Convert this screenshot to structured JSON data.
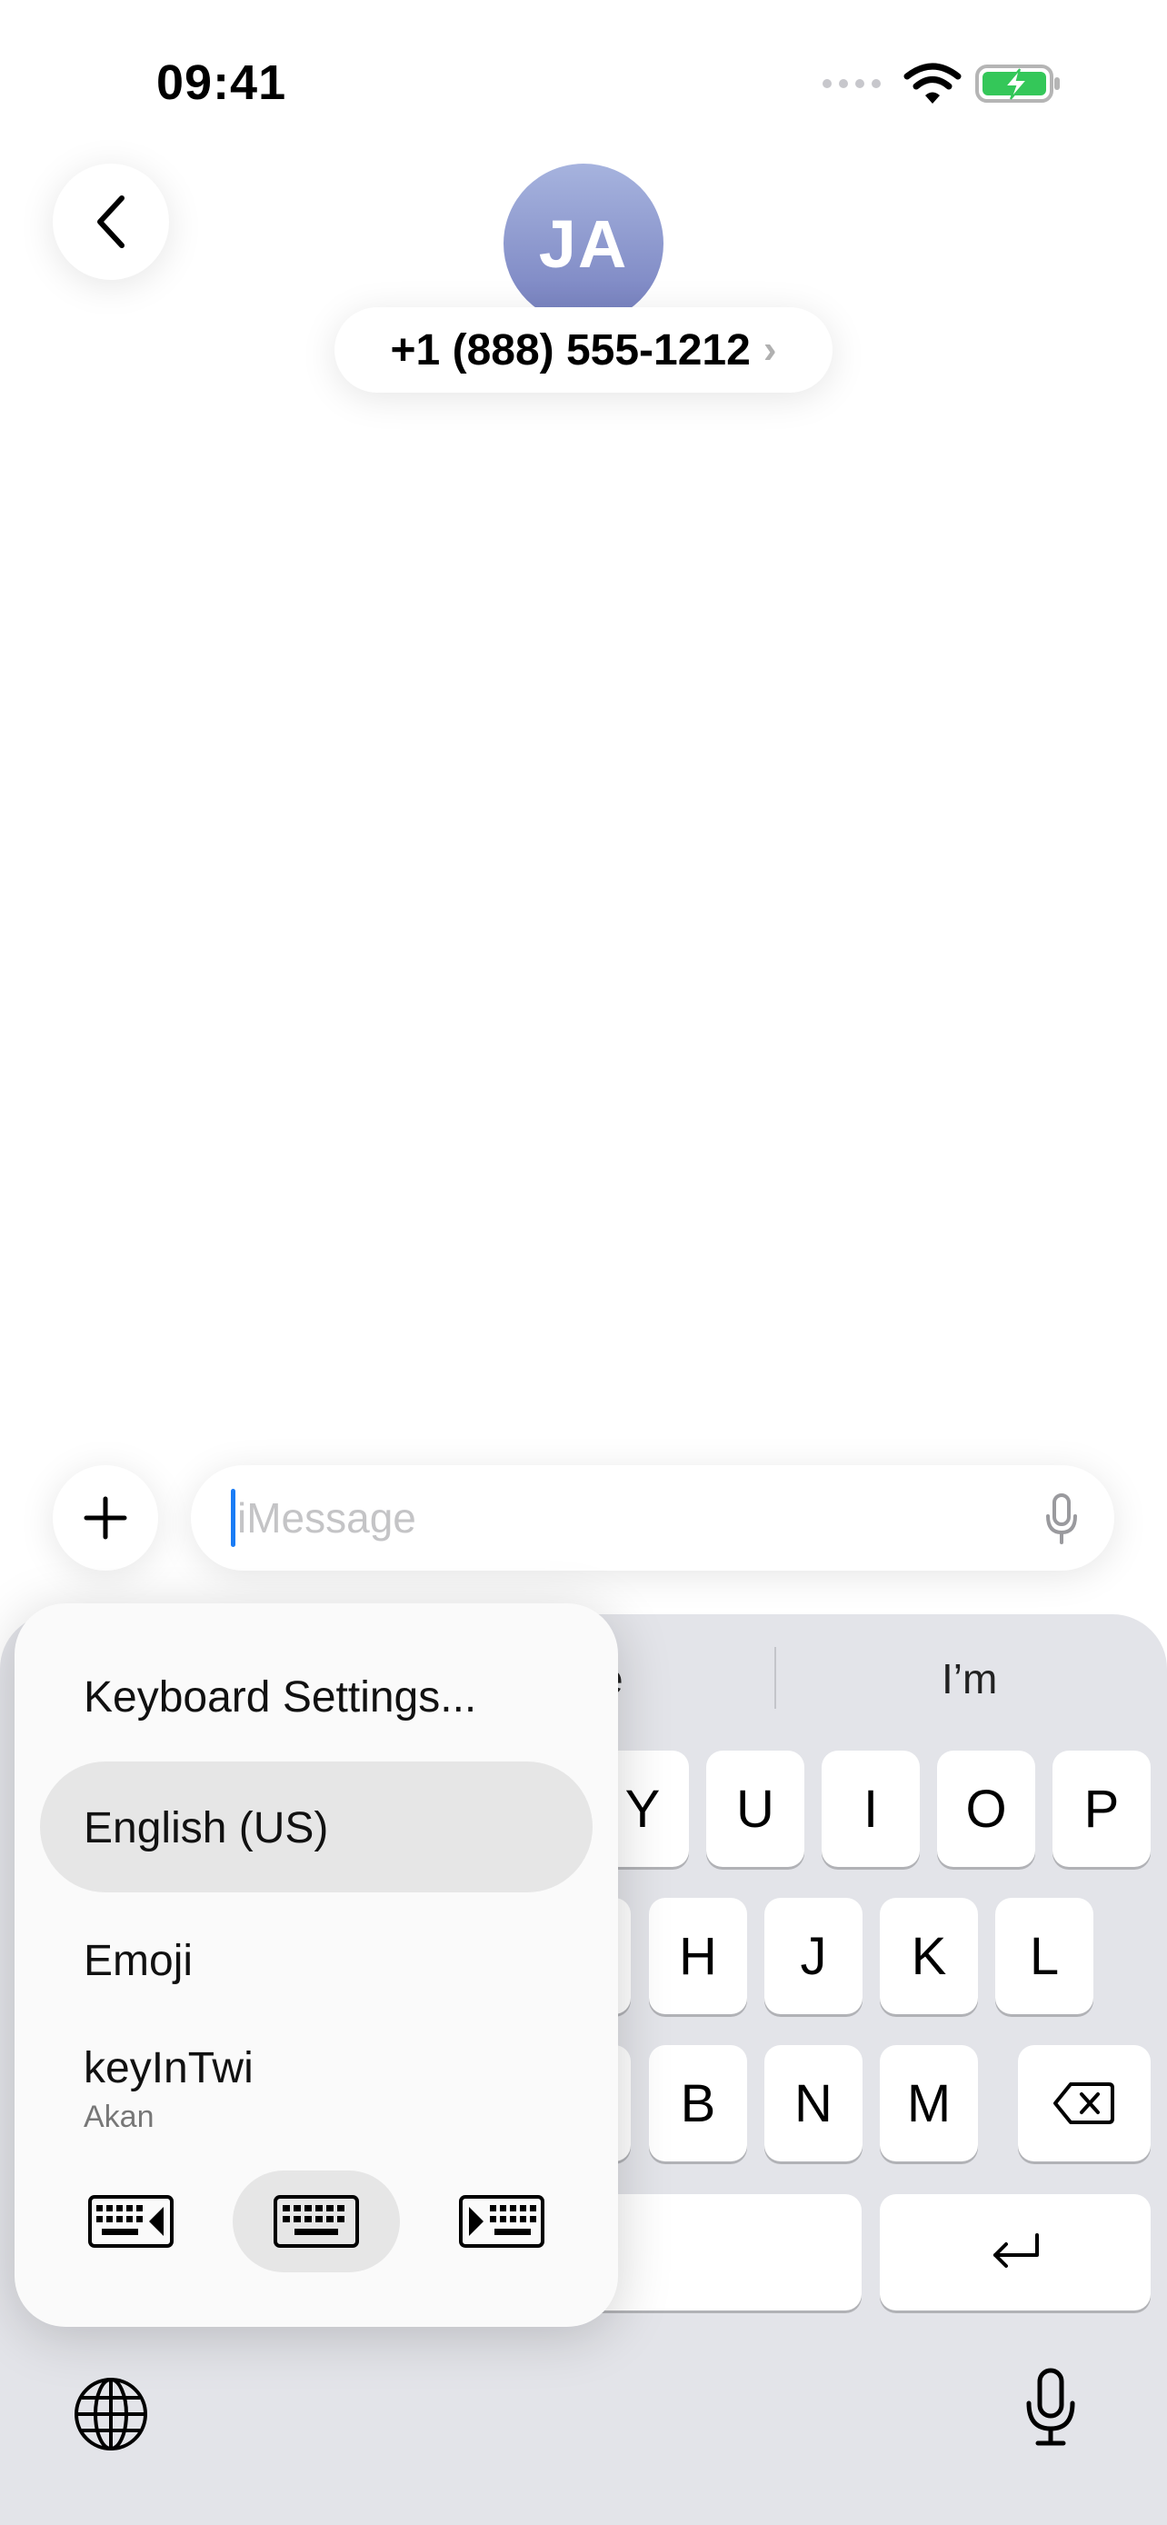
{
  "status_bar": {
    "time": "09:41"
  },
  "header": {
    "avatar_initials": "JA",
    "contact_number": "+1 (888) 555-1212",
    "chevron": "›"
  },
  "input": {
    "placeholder": "iMessage"
  },
  "keyboard": {
    "suggestions": [
      "e",
      "I’m"
    ],
    "row1": [
      "Y",
      "U",
      "I",
      "O",
      "P"
    ],
    "row2": [
      "H",
      "J",
      "K",
      "L"
    ],
    "row3": [
      "B",
      "N",
      "M"
    ]
  },
  "keyboard_menu": {
    "items": [
      "Keyboard Settings...",
      "English (US)",
      "Emoji",
      "keyInTwi"
    ],
    "keyintwi_subtitle": "Akan",
    "selected_item": "English (US)"
  },
  "icons": {
    "back": "chevron-left-icon",
    "plus": "plus-icon",
    "mic": "microphone-icon",
    "globe": "globe-icon",
    "delete": "backspace-icon",
    "return": "return-icon",
    "keyboard_left": "keyboard-left-icon",
    "keyboard_full": "keyboard-full-icon",
    "keyboard_right": "keyboard-right-icon"
  },
  "colors": {
    "battery_green": "#34c759",
    "caret_blue": "#1a7cf5",
    "keyboard_bg": "#e3e4e9"
  }
}
